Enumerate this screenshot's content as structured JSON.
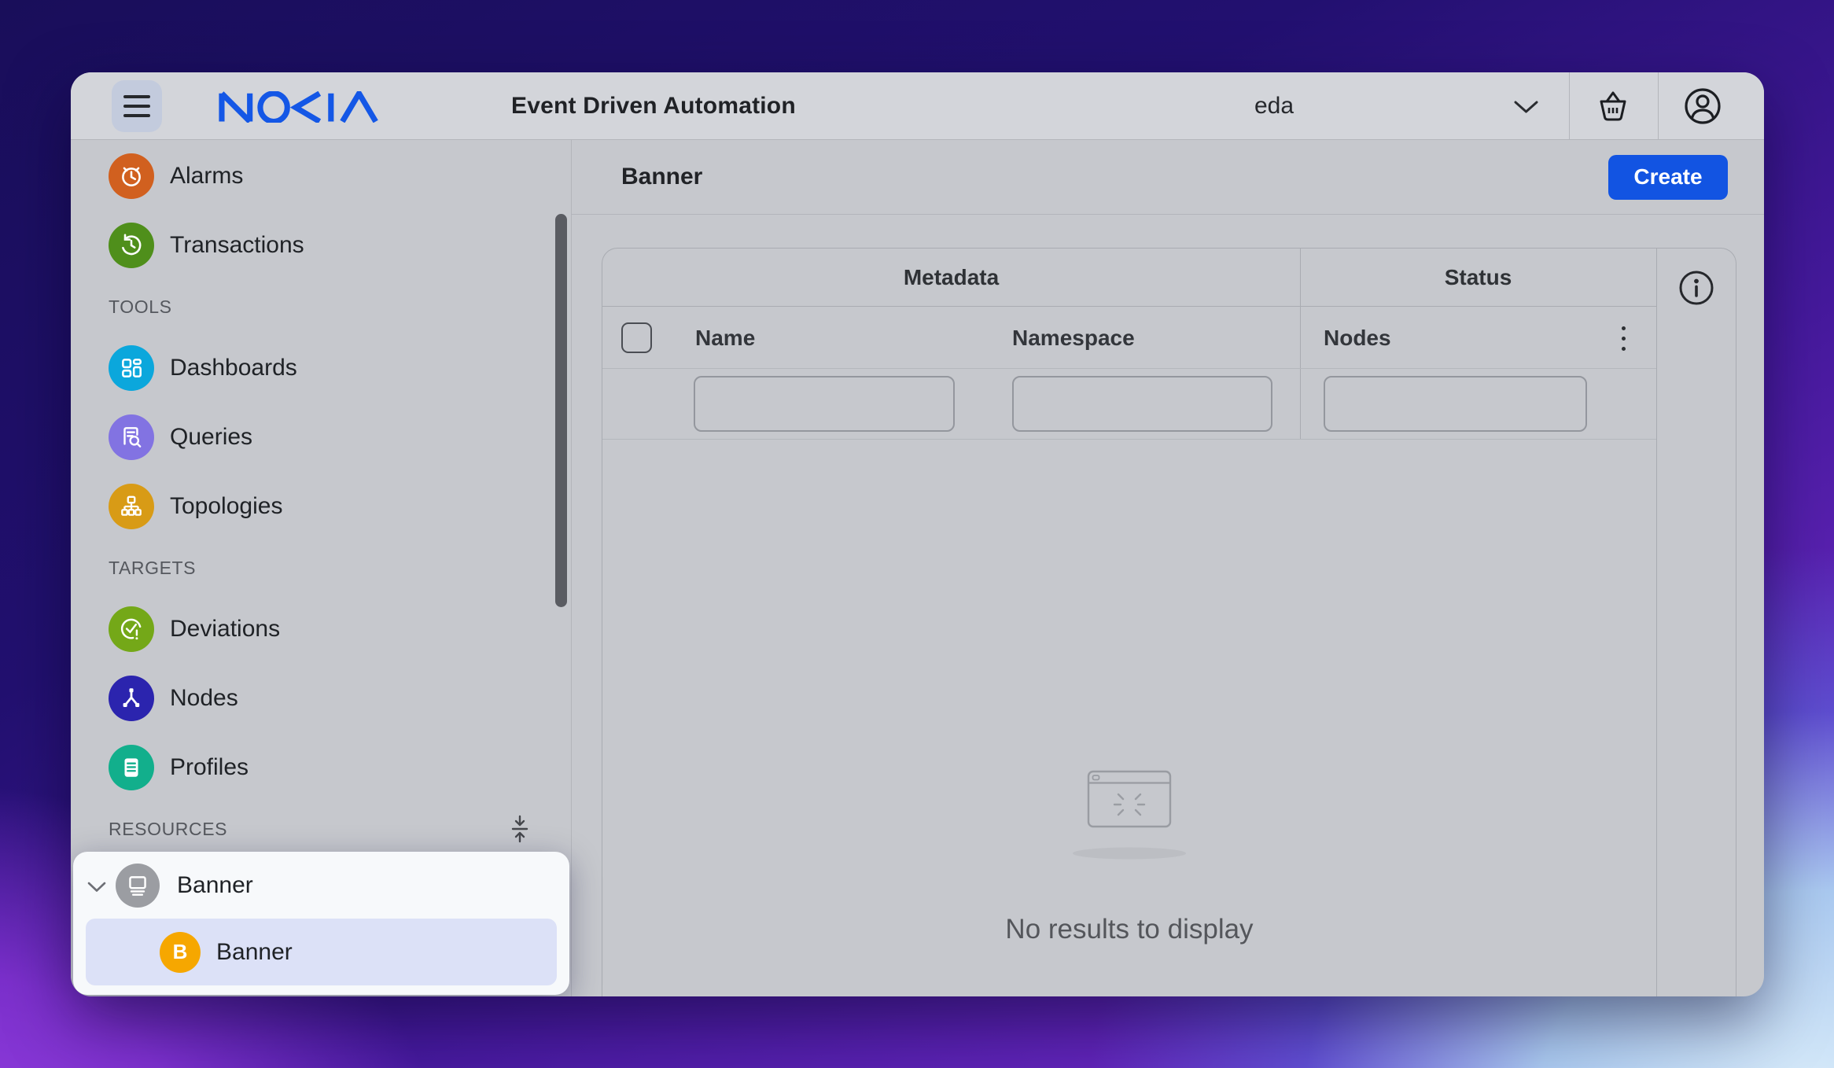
{
  "brand": {
    "logo_text": "NOKIA",
    "logo_color": "#1457e6"
  },
  "header": {
    "app_title": "Event Driven Automation",
    "tenant_selector": {
      "value": "eda"
    },
    "icons": [
      "menu-icon",
      "chevron-down-icon",
      "cart-icon",
      "user-icon"
    ]
  },
  "sidebar": {
    "sections": [
      {
        "label": "",
        "items": [
          {
            "label": "Alarms",
            "icon": "alarm-clock-icon",
            "color": "#d1601f"
          },
          {
            "label": "Transactions",
            "icon": "history-icon",
            "color": "#4f8f1b"
          }
        ]
      },
      {
        "label": "TOOLS",
        "items": [
          {
            "label": "Dashboards",
            "icon": "dashboard-icon",
            "color": "#0ba7dc"
          },
          {
            "label": "Queries",
            "icon": "document-search-icon",
            "color": "#8273e2"
          },
          {
            "label": "Topologies",
            "icon": "org-chart-icon",
            "color": "#d89b16"
          }
        ]
      },
      {
        "label": "TARGETS",
        "items": [
          {
            "label": "Deviations",
            "icon": "check-alert-icon",
            "color": "#74a818"
          },
          {
            "label": "Nodes",
            "icon": "network-node-icon",
            "color": "#2b24ae"
          },
          {
            "label": "Profiles",
            "icon": "document-lines-icon",
            "color": "#12af8c"
          }
        ]
      },
      {
        "label": "RESOURCES",
        "items": []
      }
    ],
    "spotlight": {
      "parent": {
        "label": "Banner",
        "icon": "banner-screen-icon",
        "color": "#9b9da2"
      },
      "child": {
        "label": "Banner",
        "badge": "B",
        "badge_color": "#f6a700",
        "highlight_color": "#dce1f7"
      }
    }
  },
  "page": {
    "title": "Banner",
    "create_label": "Create",
    "create_color": "#1254e2"
  },
  "table": {
    "groups": [
      {
        "label": "Metadata"
      },
      {
        "label": "Status"
      }
    ],
    "columns": [
      {
        "label": "Name"
      },
      {
        "label": "Namespace"
      },
      {
        "label": "Nodes"
      }
    ],
    "filters": {
      "name": "",
      "namespace": "",
      "nodes": ""
    },
    "empty_message": "No results to display",
    "icons": [
      "checkbox",
      "kebab-menu-icon",
      "info-icon",
      "empty-window-icon"
    ]
  }
}
